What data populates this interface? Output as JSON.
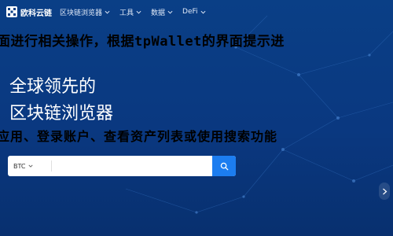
{
  "brand": {
    "name": "欧科云链"
  },
  "nav": {
    "items": [
      {
        "label": "区块链浏览器"
      },
      {
        "label": "工具"
      },
      {
        "label": "数据"
      },
      {
        "label": "DeFi"
      }
    ]
  },
  "overlay": {
    "line1": "面进行相关操作，根据tpWallet的界面提示进",
    "line2": "应用、登录账户、查看资产列表或使用搜索功能"
  },
  "hero": {
    "title_line1": "全球领先的",
    "title_line2": "区块链浏览器"
  },
  "search": {
    "coin": "BTC",
    "placeholder": "",
    "value": ""
  },
  "colors": {
    "background": "#0a3f86",
    "accent": "#1c7df0",
    "overlay_text": "#000000"
  }
}
